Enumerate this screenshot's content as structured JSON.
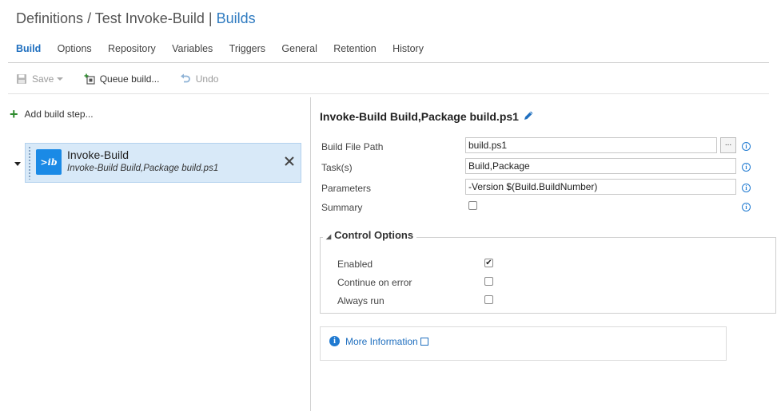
{
  "header": {
    "breadcrumb_root": "Definitions",
    "separator": "/",
    "definition_name": "Test Invoke-Build",
    "divider": "|",
    "section": "Builds"
  },
  "tabs": [
    {
      "label": "Build",
      "active": true
    },
    {
      "label": "Options"
    },
    {
      "label": "Repository"
    },
    {
      "label": "Variables"
    },
    {
      "label": "Triggers"
    },
    {
      "label": "General"
    },
    {
      "label": "Retention"
    },
    {
      "label": "History"
    }
  ],
  "toolbar": {
    "save_label": "Save",
    "queue_label": "Queue build...",
    "undo_label": "Undo"
  },
  "steps_panel": {
    "add_step_label": "Add build step...",
    "steps": [
      {
        "name": "Invoke-Build",
        "subtitle": "Invoke-Build Build,Package build.ps1",
        "logo_text": ">ib"
      }
    ]
  },
  "step_detail": {
    "title": "Invoke-Build Build,Package build.ps1",
    "fields": {
      "build_file_path": {
        "label": "Build File Path",
        "value": "build.ps1",
        "browse_label": "..."
      },
      "tasks": {
        "label": "Task(s)",
        "value": "Build,Package"
      },
      "parameters": {
        "label": "Parameters",
        "value": "-Version $(Build.BuildNumber)"
      },
      "summary": {
        "label": "Summary",
        "checked": false
      }
    },
    "control_options": {
      "title": "Control Options",
      "options": [
        {
          "label": "Enabled",
          "checked": true
        },
        {
          "label": "Continue on error",
          "checked": false
        },
        {
          "label": "Always run",
          "checked": false
        }
      ]
    },
    "more_info_label": "More Information"
  },
  "colors": {
    "accent": "#1f6fbf",
    "selected_step_bg": "#d8e9f8",
    "add_icon": "#2e8b2e",
    "task_logo_bg": "#1a8ae6"
  },
  "icons": {
    "save": "floppy-disk-icon",
    "queue": "queue-build-icon",
    "undo": "undo-icon",
    "add": "plus-icon",
    "edit": "pencil-icon",
    "info": "info-icon",
    "remove": "close-icon",
    "external": "external-link-icon"
  }
}
